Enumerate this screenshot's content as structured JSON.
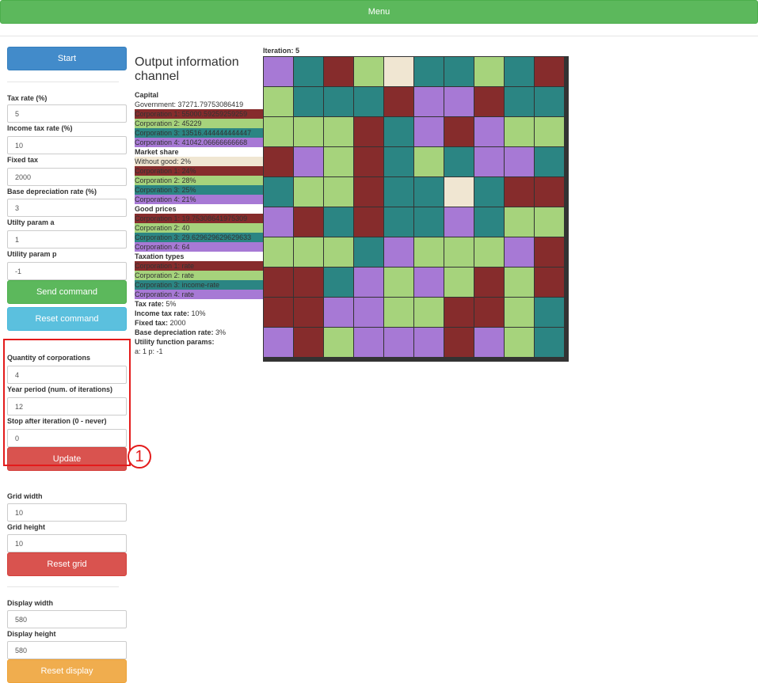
{
  "menu": {
    "label": "Menu"
  },
  "sidebar": {
    "start_label": "Start",
    "tax_rate": {
      "label": "Tax rate (%)",
      "value": "5"
    },
    "income_tax_rate": {
      "label": "Income tax rate (%)",
      "value": "10"
    },
    "fixed_tax": {
      "label": "Fixed tax",
      "value": "2000"
    },
    "base_depreciation_rate": {
      "label": "Base depreciation rate (%)",
      "value": "3"
    },
    "utility_a": {
      "label": "Utilty param a",
      "value": "1"
    },
    "utility_p": {
      "label": "Utility param p",
      "value": "-1"
    },
    "send_command_label": "Send command",
    "reset_command_label": "Reset command",
    "quantity": {
      "label": "Quantity of corporations",
      "value": "4"
    },
    "year_period": {
      "label": "Year period (num. of iterations)",
      "value": "12"
    },
    "stop_after": {
      "label": "Stop after iteration (0 - never)",
      "value": "0"
    },
    "update_label": "Update",
    "grid_width": {
      "label": "Grid width",
      "value": "10"
    },
    "grid_height": {
      "label": "Grid height",
      "value": "10"
    },
    "reset_grid_label": "Reset grid",
    "display_width": {
      "label": "Display width",
      "value": "580"
    },
    "display_height": {
      "label": "Display height",
      "value": "580"
    },
    "reset_display_label": "Reset display"
  },
  "annotation": {
    "marker": "1"
  },
  "colors": {
    "government": "#fff",
    "without": "#f0e6d2",
    "corp1": "#862c2c",
    "corp2": "#a6d37c",
    "corp3": "#2b8583",
    "corp4": "#a779d5"
  },
  "output": {
    "title": "Output information channel",
    "capital_title": "Capital",
    "capital": [
      {
        "text": "Government: 37271.79753086419",
        "color": "government"
      },
      {
        "text": "Corporation 1: 55000.59259259259",
        "color": "corp1"
      },
      {
        "text": "Corporation 2: 45229",
        "color": "corp2"
      },
      {
        "text": "Corporation 3: 13516.444444444447",
        "color": "corp3"
      },
      {
        "text": "Corporation 4: 41042.06666666668",
        "color": "corp4"
      }
    ],
    "market_title": "Market share",
    "market": [
      {
        "text": "Without good: 2%",
        "color": "without"
      },
      {
        "text": "Corporation 1: 24%",
        "color": "corp1"
      },
      {
        "text": "Corporation 2: 28%",
        "color": "corp2"
      },
      {
        "text": "Corporation 3: 25%",
        "color": "corp3"
      },
      {
        "text": "Corporation 4: 21%",
        "color": "corp4"
      }
    ],
    "prices_title": "Good prices",
    "prices": [
      {
        "text": "Corporation 1: 19.75308641975309",
        "color": "corp1"
      },
      {
        "text": "Corporation 2: 40",
        "color": "corp2"
      },
      {
        "text": "Corporation 3: 29.629629629629633",
        "color": "corp3"
      },
      {
        "text": "Corporation 4: 64",
        "color": "corp4"
      }
    ],
    "taxation_title": "Taxation types",
    "taxation": [
      {
        "text": "Corporation 1: rate",
        "color": "corp1"
      },
      {
        "text": "Corporation 2: rate",
        "color": "corp2"
      },
      {
        "text": "Corporation 3: income-rate",
        "color": "corp3"
      },
      {
        "text": "Corporation 4: rate",
        "color": "corp4"
      }
    ],
    "tax_rate_label": "Tax rate:",
    "tax_rate_value": " 5%",
    "income_tax_label": "Income tax rate:",
    "income_tax_value": " 10%",
    "fixed_tax_label": "Fixed tax:",
    "fixed_tax_value": " 2000",
    "base_dep_label": "Base depreciation rate:",
    "base_dep_value": " 3%",
    "utility_title": "Utility function params:",
    "utility_values": "a: 1 p: -1"
  },
  "iteration": {
    "label": "Iteration: 5"
  },
  "grid": [
    [
      "P",
      "T",
      "R",
      "G",
      "B",
      "T",
      "T",
      "G",
      "T",
      "R"
    ],
    [
      "G",
      "T",
      "T",
      "T",
      "R",
      "P",
      "P",
      "R",
      "T",
      "T"
    ],
    [
      "G",
      "G",
      "G",
      "R",
      "T",
      "P",
      "R",
      "P",
      "G",
      "G"
    ],
    [
      "R",
      "P",
      "G",
      "R",
      "T",
      "G",
      "T",
      "P",
      "P",
      "T"
    ],
    [
      "T",
      "G",
      "G",
      "R",
      "T",
      "T",
      "B",
      "T",
      "R",
      "R"
    ],
    [
      "P",
      "R",
      "T",
      "R",
      "T",
      "T",
      "P",
      "T",
      "G",
      "G"
    ],
    [
      "G",
      "G",
      "G",
      "T",
      "P",
      "G",
      "G",
      "G",
      "P",
      "R"
    ],
    [
      "R",
      "R",
      "T",
      "P",
      "G",
      "P",
      "G",
      "R",
      "G",
      "R"
    ],
    [
      "R",
      "R",
      "P",
      "P",
      "G",
      "G",
      "R",
      "R",
      "G",
      "T"
    ],
    [
      "P",
      "R",
      "G",
      "P",
      "P",
      "P",
      "R",
      "P",
      "G",
      "T"
    ]
  ],
  "grid_legend": {
    "R": "corp1",
    "G": "corp2",
    "T": "corp3",
    "P": "corp4",
    "B": "without"
  }
}
